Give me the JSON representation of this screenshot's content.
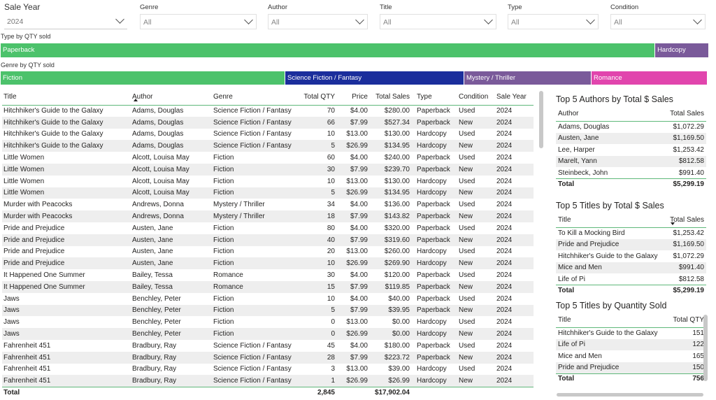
{
  "slicers": {
    "sale_year": {
      "label": "Sale Year",
      "value": "2024"
    },
    "genre": {
      "label": "Genre",
      "value": "All"
    },
    "author": {
      "label": "Author",
      "value": "All"
    },
    "title": {
      "label": "Title",
      "value": "All"
    },
    "type": {
      "label": "Type",
      "value": "All"
    },
    "condition": {
      "label": "Condition",
      "value": "All"
    }
  },
  "type_bar": {
    "title": "Type by QTY sold",
    "segments": [
      {
        "label": "Paperback",
        "color": "#4cc26b"
      },
      {
        "label": "Hardcopy",
        "color": "#7a5a9a"
      }
    ]
  },
  "genre_bar": {
    "title": "Genre by QTY sold",
    "segments": [
      {
        "label": "Fiction",
        "color": "#4cc26b"
      },
      {
        "label": "Science Fiction / Fantasy",
        "color": "#1b2e9c"
      },
      {
        "label": "Mystery / Thriller",
        "color": "#7a5a9a"
      },
      {
        "label": "Romance",
        "color": "#e145ad"
      }
    ]
  },
  "main_table": {
    "headers": [
      "Title",
      "Author",
      "Genre",
      "Total QTY",
      "Price",
      "Total Sales",
      "Type",
      "Condition",
      "Sale Year"
    ],
    "rows": [
      [
        "Hitchhiker's Guide to the Galaxy",
        "Adams, Douglas",
        "Science Fiction / Fantasy",
        "70",
        "$4.00",
        "$280.00",
        "Paperback",
        "Used",
        "2024"
      ],
      [
        "Hitchhiker's Guide to the Galaxy",
        "Adams, Douglas",
        "Science Fiction / Fantasy",
        "66",
        "$7.99",
        "$527.34",
        "Paperback",
        "New",
        "2024"
      ],
      [
        "Hitchhiker's Guide to the Galaxy",
        "Adams, Douglas",
        "Science Fiction / Fantasy",
        "10",
        "$13.00",
        "$130.00",
        "Hardcopy",
        "Used",
        "2024"
      ],
      [
        "Hitchhiker's Guide to the Galaxy",
        "Adams, Douglas",
        "Science Fiction / Fantasy",
        "5",
        "$26.99",
        "$134.95",
        "Hardcopy",
        "New",
        "2024"
      ],
      [
        "Little Women",
        "Alcott, Louisa May",
        "Fiction",
        "60",
        "$4.00",
        "$240.00",
        "Paperback",
        "Used",
        "2024"
      ],
      [
        "Little Women",
        "Alcott, Louisa May",
        "Fiction",
        "30",
        "$7.99",
        "$239.70",
        "Paperback",
        "New",
        "2024"
      ],
      [
        "Little Women",
        "Alcott, Louisa May",
        "Fiction",
        "10",
        "$13.00",
        "$130.00",
        "Hardcopy",
        "Used",
        "2024"
      ],
      [
        "Little Women",
        "Alcott, Louisa May",
        "Fiction",
        "5",
        "$26.99",
        "$134.95",
        "Hardcopy",
        "New",
        "2024"
      ],
      [
        "Murder with Peacocks",
        "Andrews, Donna",
        "Mystery / Thriller",
        "34",
        "$4.00",
        "$136.00",
        "Paperback",
        "Used",
        "2024"
      ],
      [
        "Murder with Peacocks",
        "Andrews, Donna",
        "Mystery / Thriller",
        "18",
        "$7.99",
        "$143.82",
        "Paperback",
        "New",
        "2024"
      ],
      [
        "Pride and Prejudice",
        "Austen, Jane",
        "Fiction",
        "80",
        "$4.00",
        "$320.00",
        "Paperback",
        "Used",
        "2024"
      ],
      [
        "Pride and Prejudice",
        "Austen, Jane",
        "Fiction",
        "40",
        "$7.99",
        "$319.60",
        "Paperback",
        "New",
        "2024"
      ],
      [
        "Pride and Prejudice",
        "Austen, Jane",
        "Fiction",
        "20",
        "$13.00",
        "$260.00",
        "Hardcopy",
        "Used",
        "2024"
      ],
      [
        "Pride and Prejudice",
        "Austen, Jane",
        "Fiction",
        "10",
        "$26.99",
        "$269.90",
        "Hardcopy",
        "New",
        "2024"
      ],
      [
        "It Happened One Summer",
        "Bailey, Tessa",
        "Romance",
        "30",
        "$4.00",
        "$120.00",
        "Paperback",
        "Used",
        "2024"
      ],
      [
        "It Happened One Summer",
        "Bailey, Tessa",
        "Romance",
        "15",
        "$7.99",
        "$119.85",
        "Paperback",
        "New",
        "2024"
      ],
      [
        "Jaws",
        "Benchley, Peter",
        "Fiction",
        "10",
        "$4.00",
        "$40.00",
        "Paperback",
        "Used",
        "2024"
      ],
      [
        "Jaws",
        "Benchley, Peter",
        "Fiction",
        "5",
        "$7.99",
        "$39.95",
        "Paperback",
        "New",
        "2024"
      ],
      [
        "Jaws",
        "Benchley, Peter",
        "Fiction",
        "0",
        "$13.00",
        "$0.00",
        "Hardcopy",
        "Used",
        "2024"
      ],
      [
        "Jaws",
        "Benchley, Peter",
        "Fiction",
        "0",
        "$26.99",
        "$0.00",
        "Hardcopy",
        "New",
        "2024"
      ],
      [
        "Fahrenheit 451",
        "Bradbury, Ray",
        "Science Fiction / Fantasy",
        "45",
        "$4.00",
        "$180.00",
        "Paperback",
        "Used",
        "2024"
      ],
      [
        "Fahrenheit 451",
        "Bradbury, Ray",
        "Science Fiction / Fantasy",
        "28",
        "$7.99",
        "$223.72",
        "Paperback",
        "New",
        "2024"
      ],
      [
        "Fahrenheit 451",
        "Bradbury, Ray",
        "Science Fiction / Fantasy",
        "3",
        "$13.00",
        "$39.00",
        "Hardcopy",
        "Used",
        "2024"
      ],
      [
        "Fahrenheit 451",
        "Bradbury, Ray",
        "Science Fiction / Fantasy",
        "1",
        "$26.99",
        "$26.99",
        "Hardcopy",
        "New",
        "2024"
      ]
    ],
    "total": {
      "label": "Total",
      "qty": "2,845",
      "sales": "$17,902.04"
    }
  },
  "top_authors": {
    "title": "Top 5 Authors by Total $ Sales",
    "headers": [
      "Author",
      "Total Sales"
    ],
    "rows": [
      [
        "Adams, Douglas",
        "$1,072.29"
      ],
      [
        "Austen, Jane",
        "$1,169.50"
      ],
      [
        "Lee, Harper",
        "$1,253.42"
      ],
      [
        "Marelt, Yann",
        "$812.58"
      ],
      [
        "Steinbeck, John",
        "$991.40"
      ]
    ],
    "total": [
      "Total",
      "$5,299.19"
    ]
  },
  "top_titles_sales": {
    "title": "Top 5 Titles by Total $ Sales",
    "headers": [
      "Title",
      "Total Sales"
    ],
    "rows": [
      [
        "To Kill a Mocking Bird",
        "$1,253.42"
      ],
      [
        "Pride and Prejudice",
        "$1,169.50"
      ],
      [
        "Hitchhiker's Guide to the Galaxy",
        "$1,072.29"
      ],
      [
        "Mice and Men",
        "$991.40"
      ],
      [
        "Life of Pi",
        "$812.58"
      ]
    ],
    "total": [
      "Total",
      "$5,299.19"
    ]
  },
  "top_titles_qty": {
    "title": "Top 5 Titles by Quantity Sold",
    "headers": [
      "Title",
      "Total QTY"
    ],
    "rows": [
      [
        "Hitchhiker's Guide to the Galaxy",
        "151"
      ],
      [
        "Life of Pi",
        "122"
      ],
      [
        "Mice and Men",
        "165"
      ],
      [
        "Pride and Prejudice",
        "150"
      ]
    ],
    "total": [
      "Total",
      "756"
    ]
  }
}
